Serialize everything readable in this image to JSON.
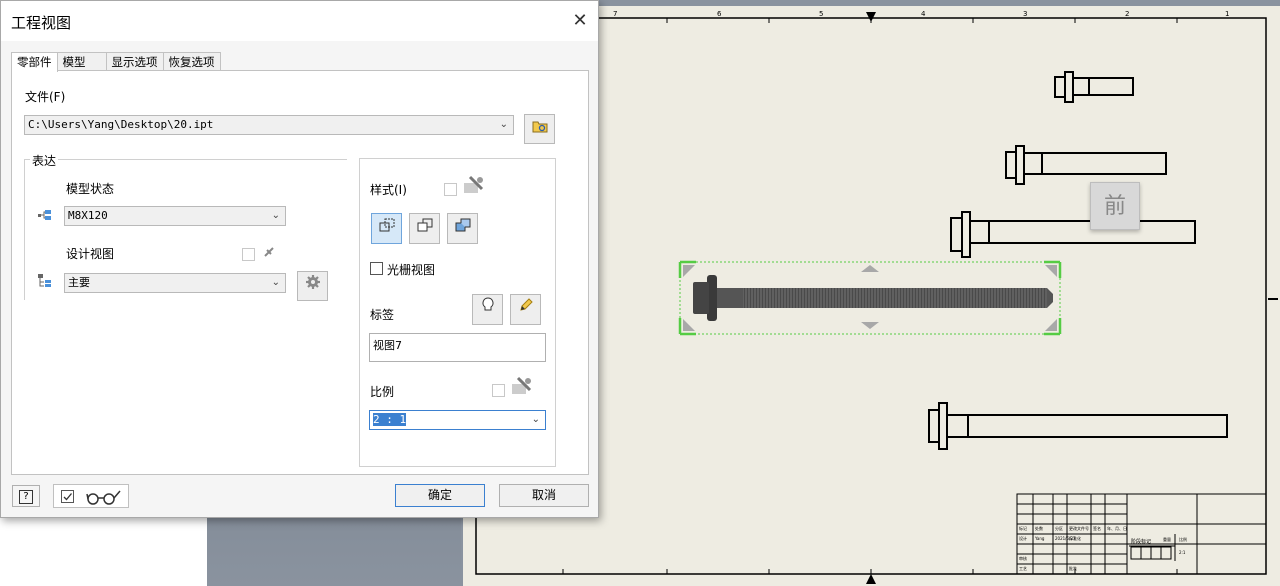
{
  "dialog": {
    "title": "工程视图",
    "close_glyph": "✕",
    "tabs": [
      {
        "label": "零部件"
      },
      {
        "label": "模型"
      },
      {
        "label": "显示选项"
      },
      {
        "label": "恢复选项"
      }
    ],
    "file": {
      "label": "文件(F)",
      "path": "C:\\Users\\Yang\\Desktop\\20.ipt"
    },
    "representation": {
      "group_title": "表达",
      "model_state_label": "模型状态",
      "model_state_value": "M8X120",
      "design_view_label": "设计视图",
      "design_view_value": "主要"
    },
    "style": {
      "label": "样式(I)",
      "raster_view_label": "光栅视图"
    },
    "label_section": {
      "label": "标签",
      "value": "视图7"
    },
    "scale": {
      "label": "比例",
      "value": "2 : 1"
    },
    "buttons": {
      "ok": "确定",
      "cancel": "取消",
      "help": "?"
    }
  },
  "viewcube_label": "前",
  "title_block": {
    "cells": [
      "标记",
      "处数",
      "分区",
      "更改文件号",
      "签名",
      "年、月、日",
      "设计",
      "Yang",
      "2021/6/27",
      "标准化",
      "审核",
      "工艺",
      "批准",
      "阶段标记",
      "重量",
      "比例",
      "2:1"
    ]
  },
  "border_numbers_top": [
    "7",
    "6",
    "5",
    "4",
    "3",
    "2",
    "1"
  ],
  "colors": {
    "sheet": "#eeece2",
    "selection": "#55cc44",
    "accent": "#3b80d0"
  }
}
